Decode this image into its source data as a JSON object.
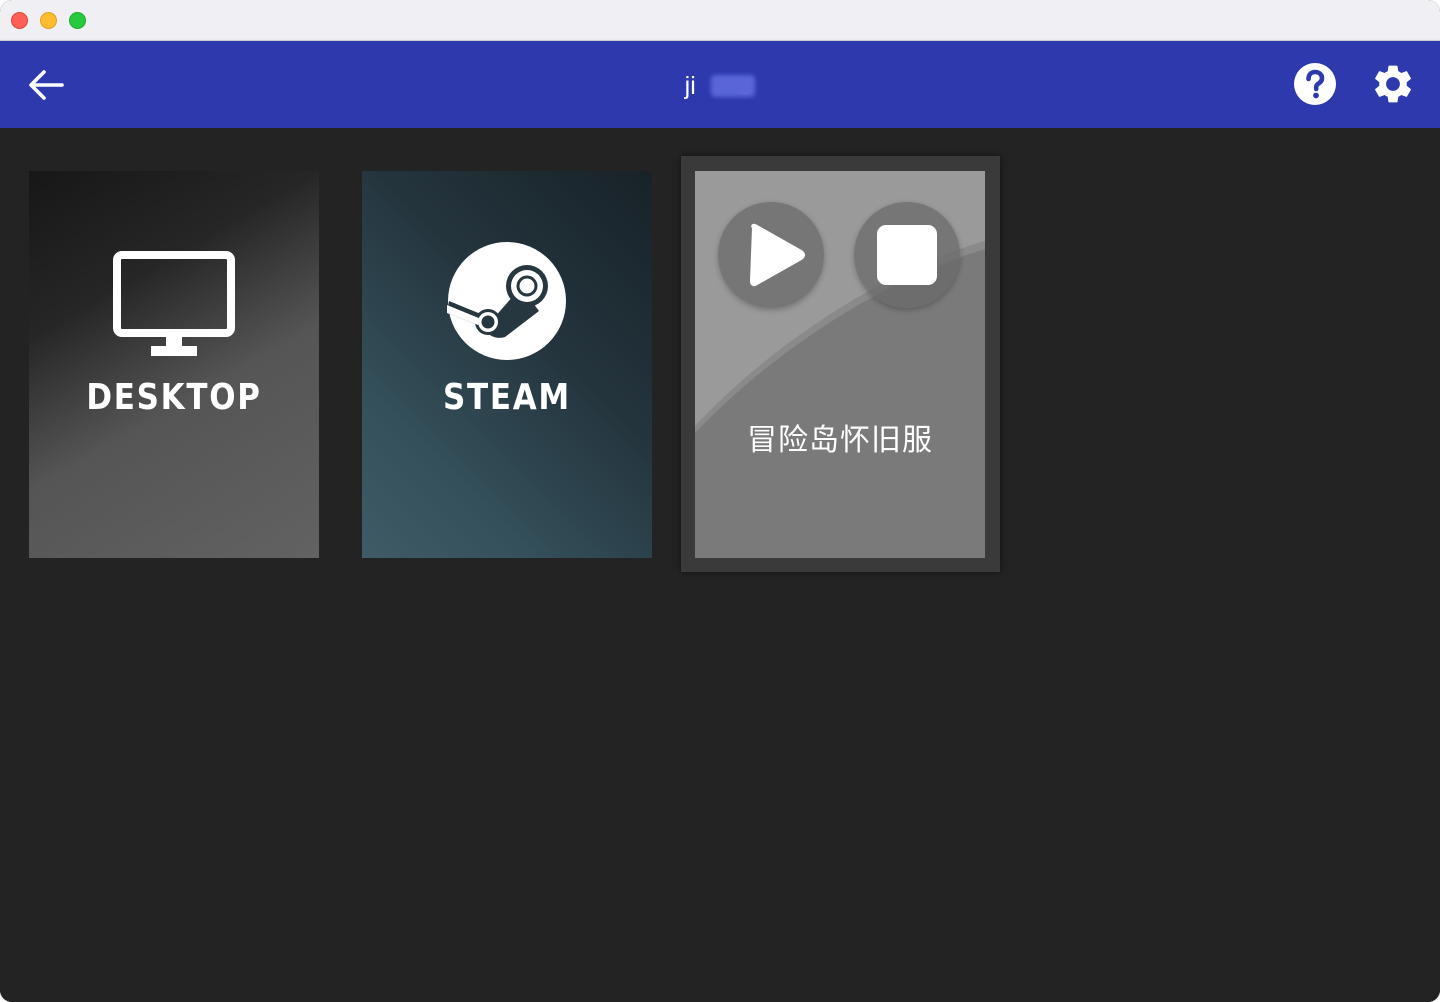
{
  "window": {
    "controls": [
      "close",
      "minimize",
      "zoom"
    ]
  },
  "appbar": {
    "title": "ji      o",
    "back_icon": "arrow-left-icon",
    "help_icon": "help-circle-icon",
    "settings_icon": "gear-icon",
    "color": "#2d39ad"
  },
  "apps": [
    {
      "label": "DESKTOP",
      "icon": "monitor-icon"
    },
    {
      "label": "STEAM",
      "icon": "steam-logo-icon"
    },
    {
      "label": "冒险岛怀旧服",
      "icon": "",
      "selected": true,
      "actions": [
        "play-icon",
        "stop-icon"
      ]
    }
  ],
  "colors": {
    "background": "#232323",
    "selected_frame": "#3a3a3a"
  }
}
